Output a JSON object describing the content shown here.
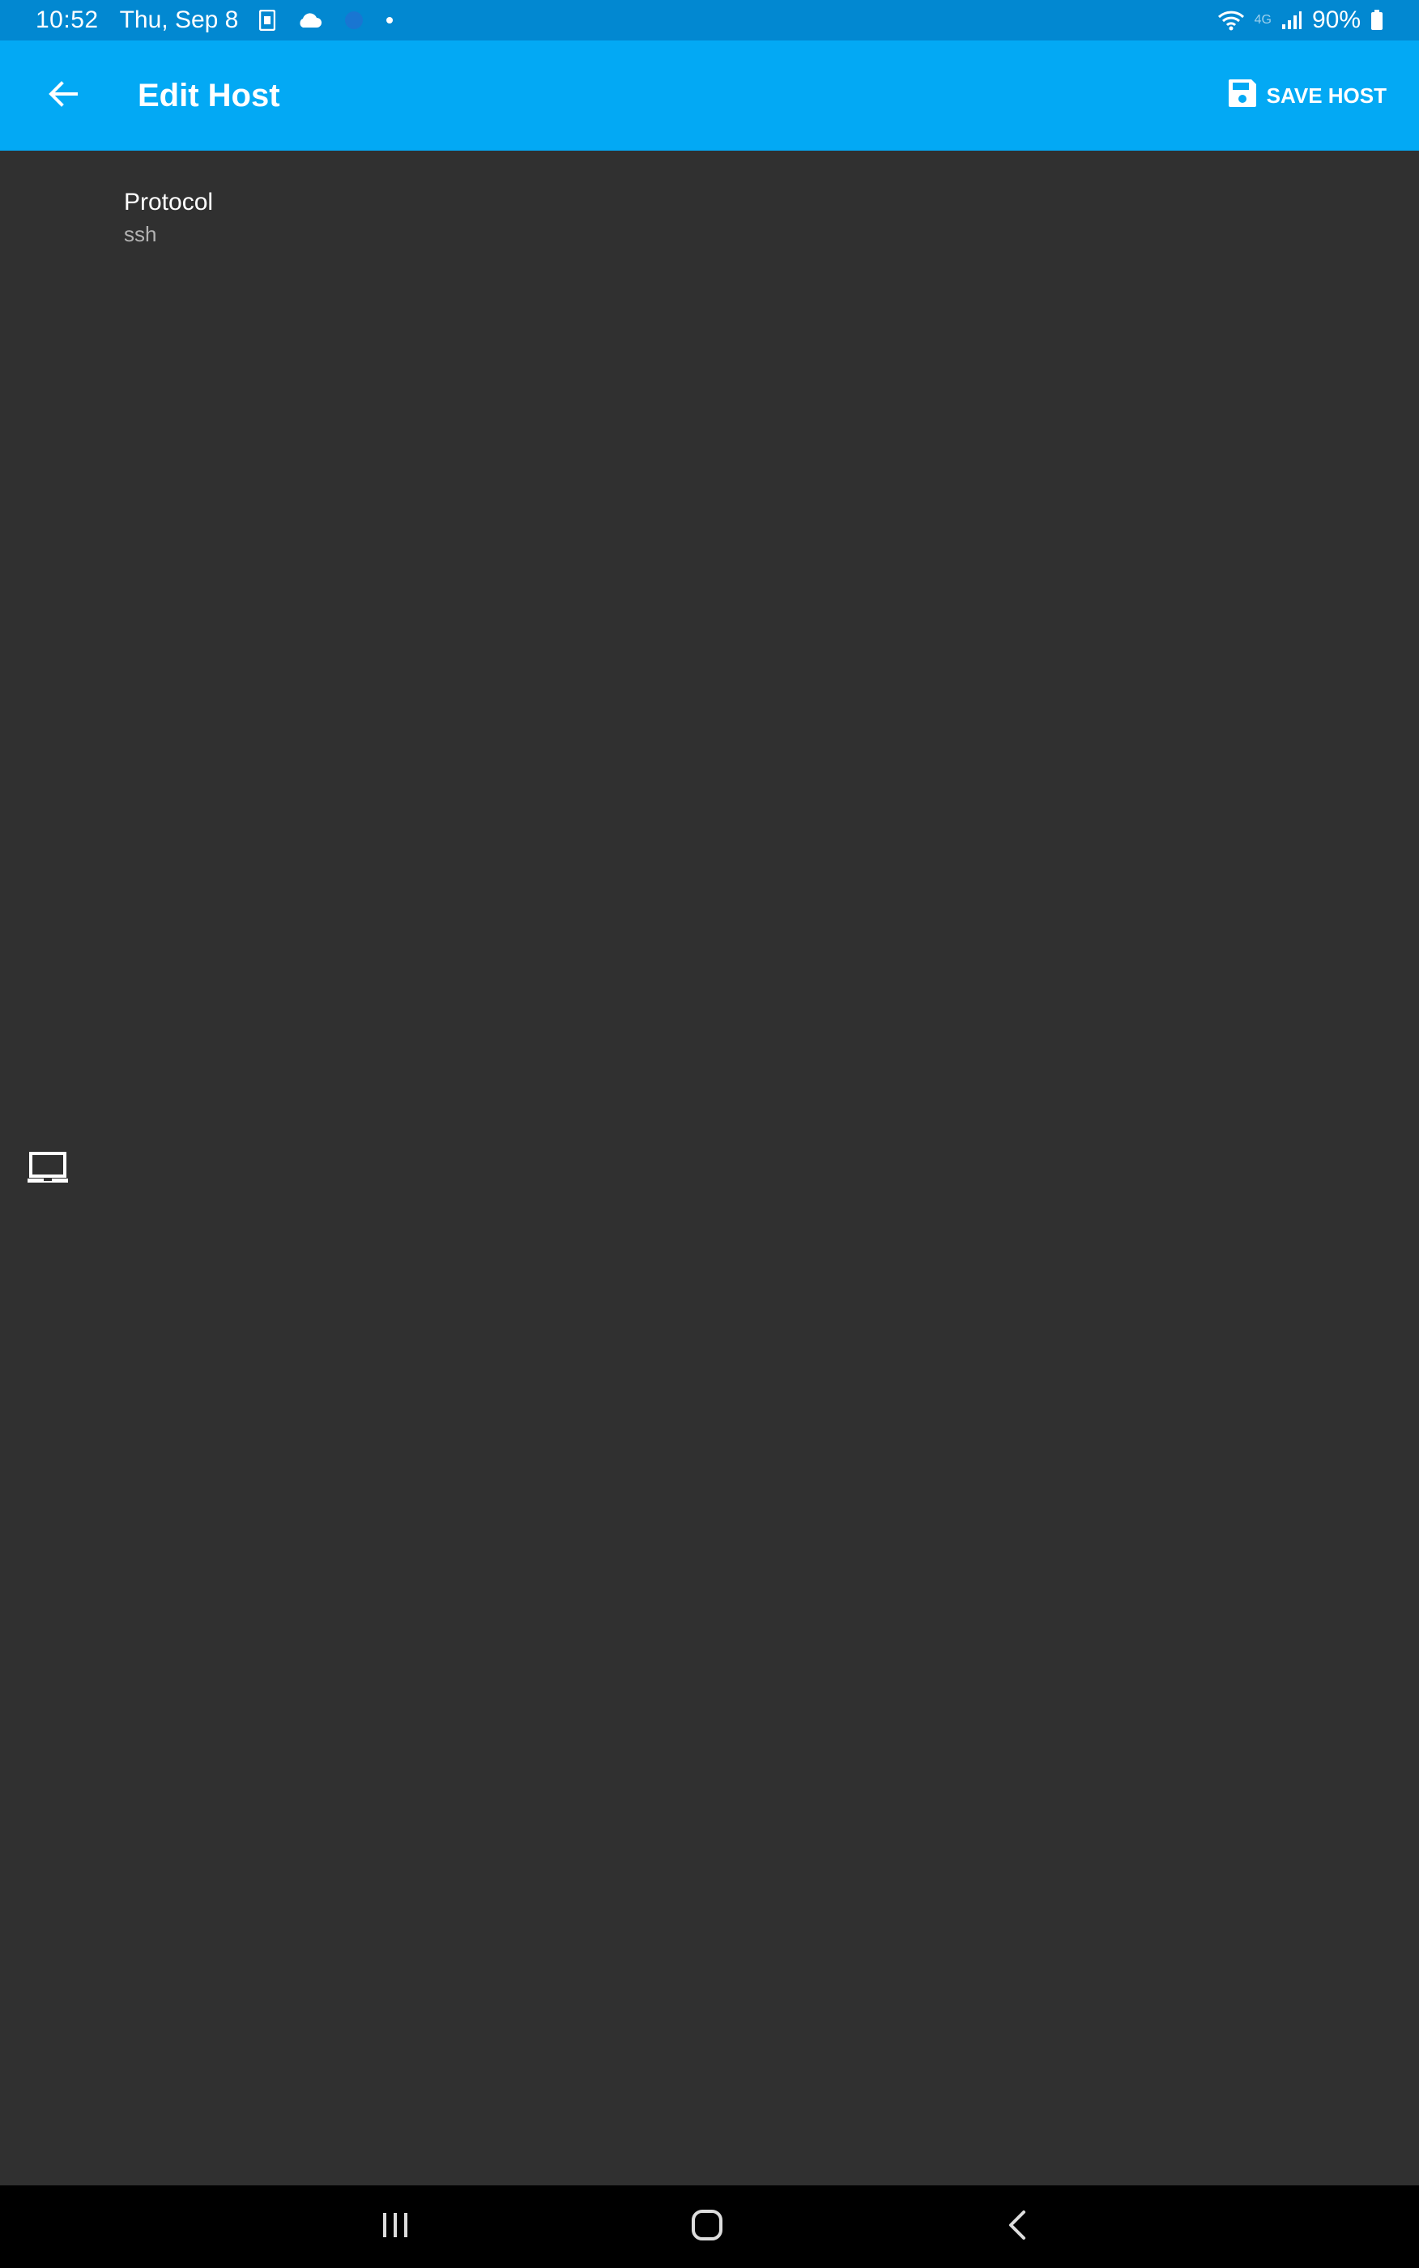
{
  "status_bar": {
    "time": "10:52",
    "date": "Thu, Sep 8",
    "battery_text": "90%",
    "network_label": "4G",
    "icons": [
      "sim-card-icon",
      "cloud-icon",
      "circle-icon",
      "dot-icon",
      "wifi-icon",
      "signal-icon",
      "battery-icon"
    ]
  },
  "app_bar": {
    "title": "Edit Host",
    "save_label": "SAVE HOST",
    "back_icon": "back-arrow-icon",
    "save_icon": "floppy-disk-icon"
  },
  "preferences": {
    "protocol": {
      "title": "Protocol",
      "summary": "ssh"
    }
  },
  "content_icon": "laptop-icon",
  "nav_bar": {
    "icons": [
      "recent-apps-icon",
      "home-icon",
      "back-icon"
    ]
  },
  "colors": {
    "status_bar": "#0288d1",
    "app_bar": "#03a9f4",
    "background": "#303030",
    "nav_bar": "#000000"
  }
}
